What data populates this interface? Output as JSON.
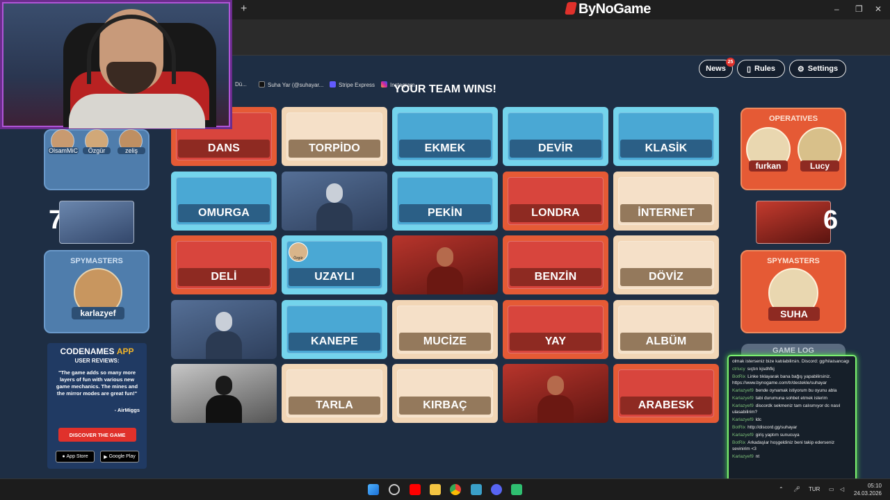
{
  "browser": {
    "brand": "ByNoGame",
    "new_tab": "+",
    "bookmarks": [
      {
        "label": "Dü..."
      },
      {
        "label": "Suha Yar (@suhayar..."
      },
      {
        "label": "Stripe Express"
      },
      {
        "label": "Instagram"
      }
    ],
    "window_controls": [
      "–",
      "❐",
      "✕"
    ]
  },
  "header": {
    "news_label": "News",
    "news_count": "25",
    "rules_label": "Rules",
    "settings_label": "Settings",
    "result": "YOUR TEAM WINS!"
  },
  "board": [
    {
      "word": "DANS",
      "team": "red"
    },
    {
      "word": "TORPİDO",
      "team": "neutral"
    },
    {
      "word": "EKMEK",
      "team": "blue"
    },
    {
      "word": "DEVİR",
      "team": "blue"
    },
    {
      "word": "KLASİK",
      "team": "blue"
    },
    {
      "word": "OMURGA",
      "team": "blue"
    },
    {
      "word": "",
      "team": "agent-blue"
    },
    {
      "word": "PEKİN",
      "team": "blue"
    },
    {
      "word": "LONDRA",
      "team": "red"
    },
    {
      "word": "İNTERNET",
      "team": "neutral"
    },
    {
      "word": "DELİ",
      "team": "red"
    },
    {
      "word": "UZAYLI",
      "team": "blue",
      "marker": "Özgür"
    },
    {
      "word": "",
      "team": "agent-red"
    },
    {
      "word": "BENZİN",
      "team": "red"
    },
    {
      "word": "DÖVİZ",
      "team": "neutral"
    },
    {
      "word": "",
      "team": "agent-blue"
    },
    {
      "word": "KANEPE",
      "team": "blue"
    },
    {
      "word": "MUCİZE",
      "team": "neutral"
    },
    {
      "word": "YAY",
      "team": "red"
    },
    {
      "word": "ALBÜM",
      "team": "neutral"
    },
    {
      "word": "",
      "team": "assassin"
    },
    {
      "word": "TARLA",
      "team": "neutral"
    },
    {
      "word": "KIRBAÇ",
      "team": "neutral"
    },
    {
      "word": "",
      "team": "agent-red"
    },
    {
      "word": "ARABESK",
      "team": "red"
    }
  ],
  "blue_team": {
    "operatives": [
      "OlsamMiC",
      "Özgür",
      "zeliş"
    ],
    "score": "7",
    "spymasters_title": "SPYMASTERS",
    "spymaster": "karlazyef"
  },
  "red_team": {
    "operatives_title": "OPERATIVES",
    "operatives": [
      "furkan",
      "Lucy"
    ],
    "score": "6",
    "spymasters_title": "SPYMASTERS",
    "spymaster": "SUHA"
  },
  "promo": {
    "title_a": "CODENAMES",
    "title_b": "APP",
    "subtitle": "USER REVIEWS:",
    "quote": "\"The game adds so many more layers of fun with various new game mechanics. The mines and the mirror modes are great fun!\"",
    "author": "- AirMiggs",
    "cta": "DISCOVER THE GAME",
    "app_store": "App Store",
    "google_play": "Google Play"
  },
  "game_log_label": "GAME LOG",
  "chat": [
    {
      "user": "",
      "text": "olmak isterseniz bize katılabilirsin. Discord: gg/hilaisancagı"
    },
    {
      "user": "ctrlucy",
      "text": "sıçtın kjsdhfkj"
    },
    {
      "user": "BotRix",
      "text": "Linke tıklayarak bana bağış yapabilirsiniz. https://www.bynogame.com/tr/destekle/suhayar"
    },
    {
      "user": "Karlazyef9",
      "text": "bende oynamak istiyorum bu oyunu abla"
    },
    {
      "user": "Karlazyef9",
      "text": "tabi durumuna sohbet etmek isterim"
    },
    {
      "user": "Karlazyef9",
      "text": "discordk sekmeniz tam calısmıyor dc nasıl ulasabilirim?"
    },
    {
      "user": "Karlazyef9",
      "text": "ldc"
    },
    {
      "user": "BotRix",
      "text": "http://discord.gg/suhayar"
    },
    {
      "user": "Karlazyef9",
      "text": "giriş yaptım sunucuya"
    },
    {
      "user": "BotRix",
      "text": "Arkadaşlar hoşgeldiniz beni takip ederseniz sevinirim <3"
    },
    {
      "user": "Karlazyef9",
      "text": "nt"
    }
  ],
  "taskbar": {
    "lang": "TUR",
    "time": "05:10",
    "date": "24.03.2026"
  }
}
